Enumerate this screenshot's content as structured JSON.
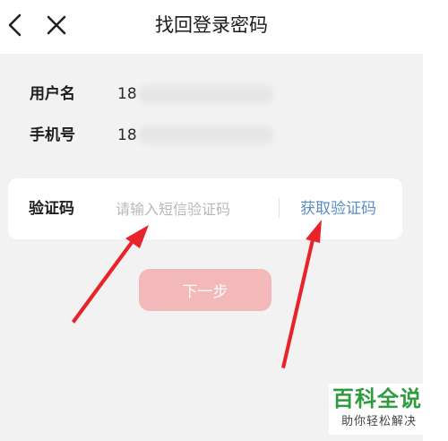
{
  "header": {
    "title": "找回登录密码",
    "back_icon": "back-chevron-icon",
    "close_icon": "close-icon"
  },
  "account": {
    "username_label": "用户名",
    "username_value": "18",
    "phone_label": "手机号",
    "phone_value": "18"
  },
  "verification": {
    "label": "验证码",
    "input_value": "",
    "input_placeholder": "请输入短信验证码",
    "get_code_label": "获取验证码"
  },
  "next_button": {
    "label": "下一步"
  },
  "watermark": {
    "main": "百科全说",
    "sub": "助你轻松解决"
  },
  "colors": {
    "background": "#f2f2f2",
    "link": "#5b8ec6",
    "button_disabled": "#f2b8ba",
    "arrow": "#e8232a",
    "watermark_green": "#2e9b3c"
  }
}
